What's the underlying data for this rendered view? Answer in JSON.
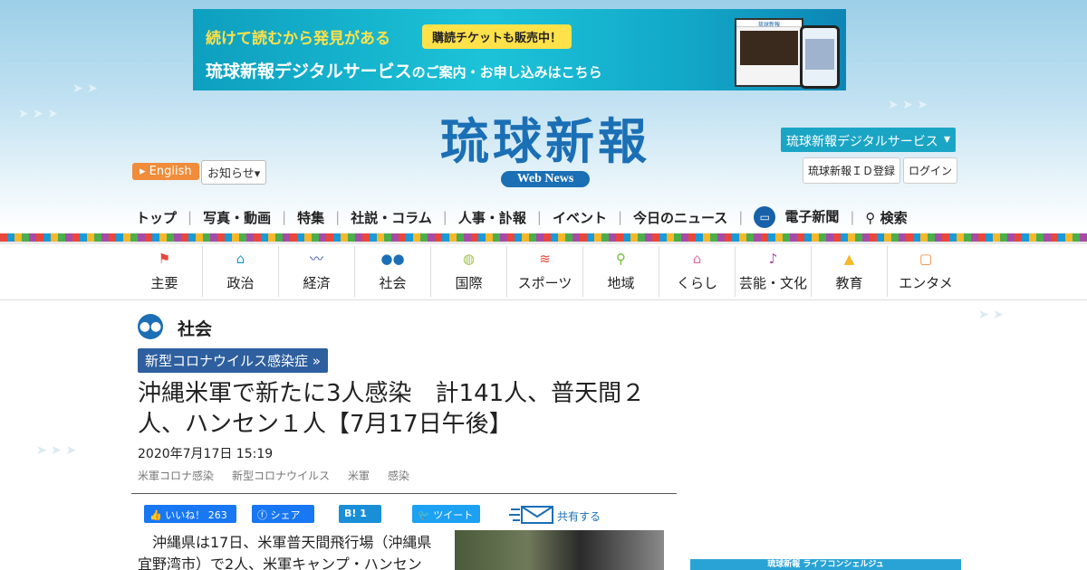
{
  "banner": {
    "line1": "続けて読むから発見がある",
    "pill": "購読チケットも販売中！",
    "line2_a": "琉球新報デジタルサービス",
    "line2_b": "のご案内・お申し込み",
    "line2_c": "はこちら",
    "device_logo": "琉球新報"
  },
  "logo": {
    "kanji": "琉球新報",
    "sub": "Web News"
  },
  "header": {
    "english": "English",
    "notice": "お知らせ",
    "digital": "琉球新報デジタルサービス",
    "id_register": "琉球新報ＩＤ登録",
    "login": "ログイン"
  },
  "mainnav": {
    "items": [
      "トップ",
      "写真・動画",
      "特集",
      "社説・コラム",
      "人事・訃報",
      "イベント",
      "今日のニュース",
      "電子新聞",
      "検索"
    ]
  },
  "catnav": {
    "items": [
      {
        "label": "主要",
        "icon": "flag-icon",
        "color": "#e8473d"
      },
      {
        "label": "政治",
        "icon": "building-icon",
        "color": "#1a9ad6"
      },
      {
        "label": "経済",
        "icon": "chart-icon",
        "color": "#3a4fa6"
      },
      {
        "label": "社会",
        "icon": "people-icon",
        "color": "#1b6fb5"
      },
      {
        "label": "国際",
        "icon": "globe-icon",
        "color": "#9bc23a"
      },
      {
        "label": "スポーツ",
        "icon": "runner-icon",
        "color": "#e8473d"
      },
      {
        "label": "地域",
        "icon": "pin-icon",
        "color": "#6cbf3a"
      },
      {
        "label": "くらし",
        "icon": "home-icon",
        "color": "#e86aa0"
      },
      {
        "label": "芸能・文化",
        "icon": "sanshin-icon",
        "color": "#a64ca6"
      },
      {
        "label": "教育",
        "icon": "graduation-icon",
        "color": "#f5b82a"
      },
      {
        "label": "エンタメ",
        "icon": "tv-icon",
        "color": "#f08c3a"
      }
    ]
  },
  "article": {
    "section": "社会",
    "tag": "新型コロナウイルス感染症 »",
    "title": "沖縄米軍で新たに3人感染　計141人、普天間２人、ハンセン１人【7月17日午後】",
    "date": "2020年7月17日 15:19",
    "keywords": [
      "米軍コロナ感染",
      "新型コロナウイルス",
      "米軍",
      "感染"
    ],
    "lead": "沖縄県は17日、米軍普天間飛行場（沖縄県宜野湾市）で2人、米軍キャンプ・ハンセン"
  },
  "share": {
    "fb_like": "いいね！ 263",
    "fb_share": "シェア",
    "hatena": "B! 1",
    "tweet": "ツイート",
    "share_text": "共有する"
  },
  "side": {
    "ad_text": "琉球新報 ライフコンシェルジュ"
  }
}
